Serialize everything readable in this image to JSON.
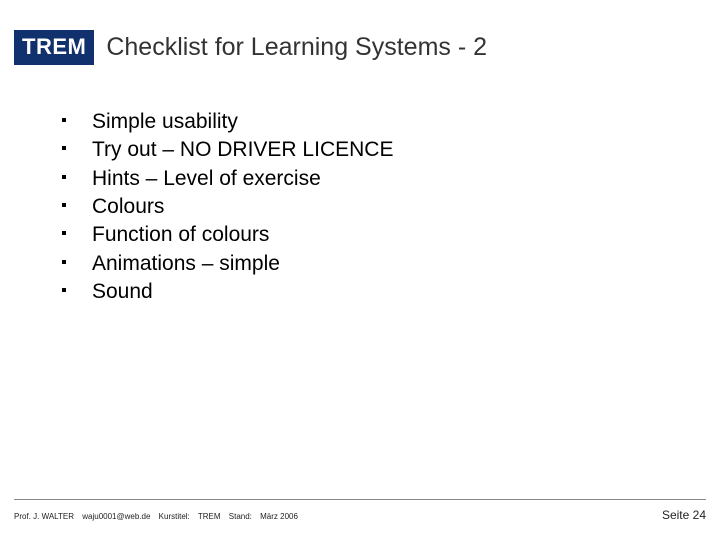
{
  "header": {
    "badge": "TREM",
    "title": "Checklist for Learning Systems - 2"
  },
  "items": [
    "Simple usability",
    "Try out – NO DRIVER LICENCE",
    "Hints – Level of exercise",
    "Colours",
    "Function of colours",
    "Animations – simple",
    "Sound"
  ],
  "footer": {
    "author": "Prof. J. WALTER",
    "email": "waju0001@web.de",
    "course_label": "Kurstitel:",
    "course": "TREM",
    "stand_label": "Stand:",
    "stand": "März 2006",
    "page_label": "Seite",
    "page_num": "24"
  }
}
